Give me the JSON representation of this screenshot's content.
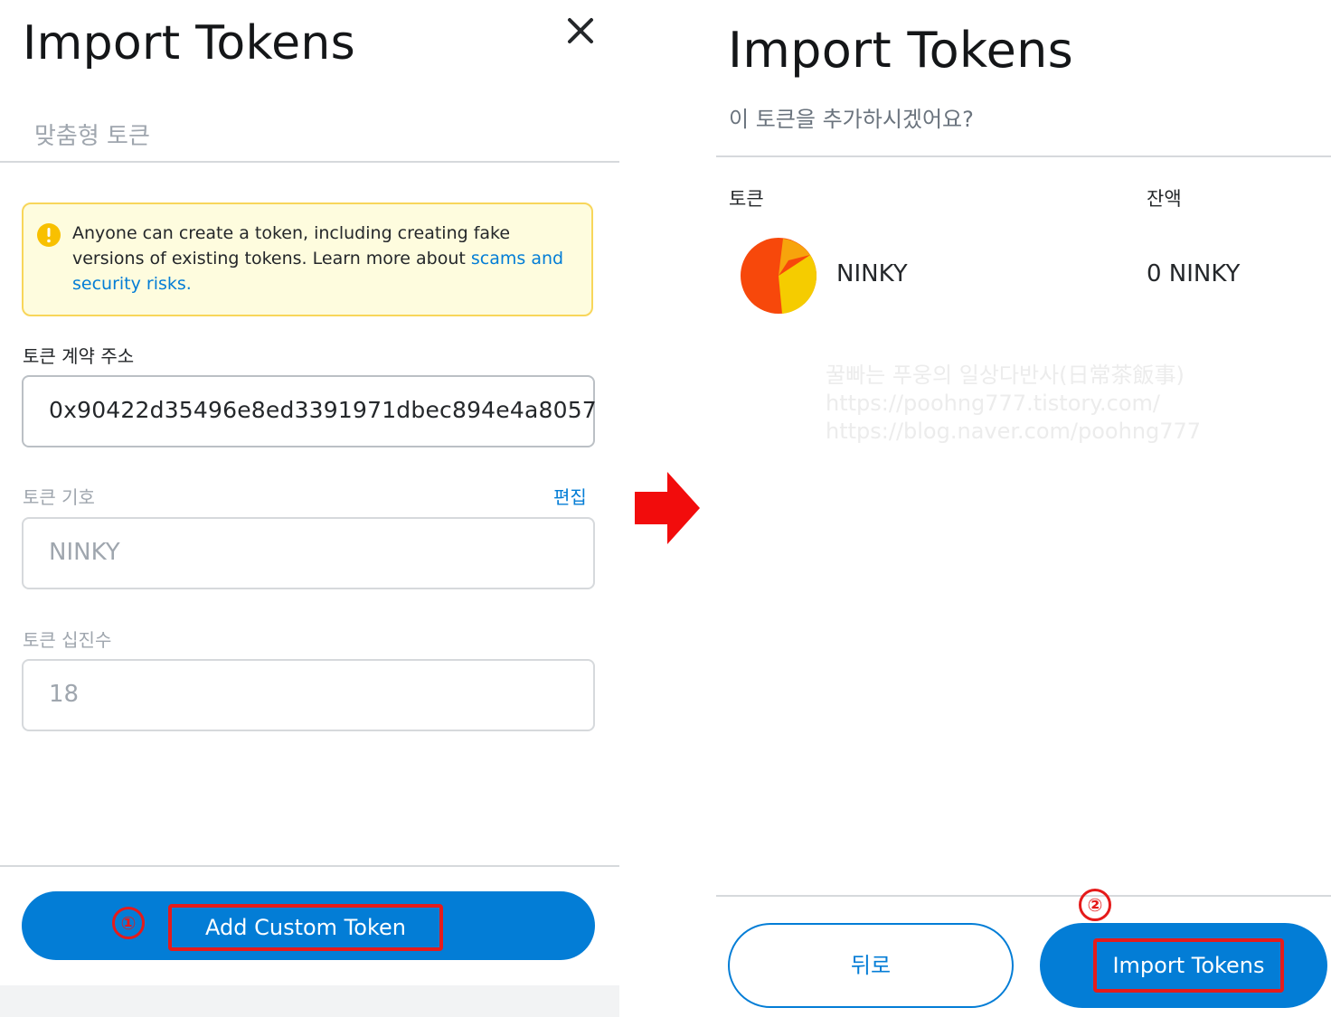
{
  "left_panel": {
    "title": "Import Tokens",
    "tab": "맞춤형 토큰",
    "warning": {
      "text": "Anyone can create a token, including creating fake versions of existing tokens. Learn more about ",
      "link": "scams and security risks."
    },
    "address_label": "토큰 계약 주소",
    "address_value": "0x90422d35496e8ed3391971dbec894e4a8057",
    "symbol_label": "토큰 기호",
    "edit_label": "편집",
    "symbol_value": "NINKY",
    "decimals_label": "토큰 십진수",
    "decimals_value": "18",
    "add_button_label": "Add Custom Token",
    "step_marker": "①"
  },
  "right_panel": {
    "title": "Import Tokens",
    "subtitle": "이 토큰을 추가하시겠어요?",
    "col_token": "토큰",
    "col_balance": "잔액",
    "token_name": "NINKY",
    "token_balance": "0 NINKY",
    "back_label": "뒤로",
    "import_label": "Import Tokens",
    "step_marker": "②"
  },
  "watermark": {
    "line1": "꿀빠는 푸웅의 일상다반사(日常茶飯事)",
    "line2": "https://poohng777.tistory.com/",
    "line3": "https://blog.naver.com/poohng777"
  },
  "colors": {
    "primary": "#037dd6",
    "highlight": "#e51b1b",
    "warning_bg": "#fefcde",
    "warning_border": "#f8d65a"
  },
  "icons": {
    "close": "close-icon",
    "warning": "warning-icon",
    "arrow": "arrow-right-icon",
    "token": "token-pie-icon"
  }
}
